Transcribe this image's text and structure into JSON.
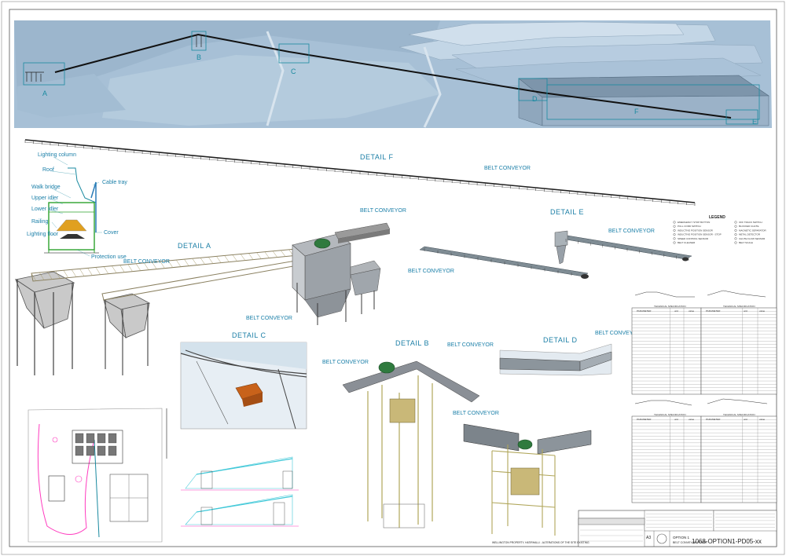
{
  "aerial_view": {
    "markers": [
      "A",
      "B",
      "C",
      "D",
      "E",
      "F"
    ]
  },
  "details": {
    "f_title": "DETAIL F",
    "a_title": "DETAIL A",
    "b_title": "DETAIL B",
    "c_title": "DETAIL C",
    "d_title": "DETAIL D",
    "e_title": "DETAIL E"
  },
  "conveyor_labels": [
    "BELT CONVEYOR",
    "BELT CONVEYOR",
    "BELT CONVEYOR",
    "BELT CONVEYOR",
    "BELT CONVEYOR",
    "BELT CONVEYOR",
    "BELT CONVEYOR",
    "BELT CONVEYOR",
    "BELT CONVEYOR",
    "BELT CONVEYOR"
  ],
  "section_labels": [
    "Lighting column",
    "Roof",
    "Walk bridge",
    "Upper idler",
    "Lower idler",
    "Railing",
    "Lighting floor",
    "Cable tray",
    "Cover",
    "Protection use"
  ],
  "legend": {
    "title": "LEGEND",
    "items": [
      "EMERGENCY STOP BUTTON",
      "PULL CORD SWITCH",
      "INDUCTIVE POSITION SENSOR",
      "INDUCTIVE POSITION SENSOR - STOP",
      "SPEED CONTROL SENSOR",
      "BELT CLEANER",
      "OFF TRACK SWITCH",
      "BLOCKED CHUTE",
      "MAGNETIC SEPARATOR",
      "METAL DETECTOR",
      "CHUTE FLOW SENSOR",
      "BELT SCALE"
    ]
  },
  "tables": {
    "header": "TECHNICAL SPECIFICATION",
    "col_parameter": "PARAMETER",
    "col_unit": "unit",
    "col_value": "value"
  },
  "titleblock": {
    "project": "WELLINGTON PROPERTY, HATIRHALLI - ALTERATIONS OF THE SITE EXISTING",
    "option": "OPTION 1",
    "subtitle": "BELT CONVEYOR ROUTE",
    "drawing_no": "1068-OPTION1-PD05-xx",
    "sheet": "A3"
  },
  "colors": {
    "terrain": "#a9c2d8",
    "label": "#1a8aa0",
    "structure": "#8a8a6a",
    "drive": "#2f7a3e"
  }
}
